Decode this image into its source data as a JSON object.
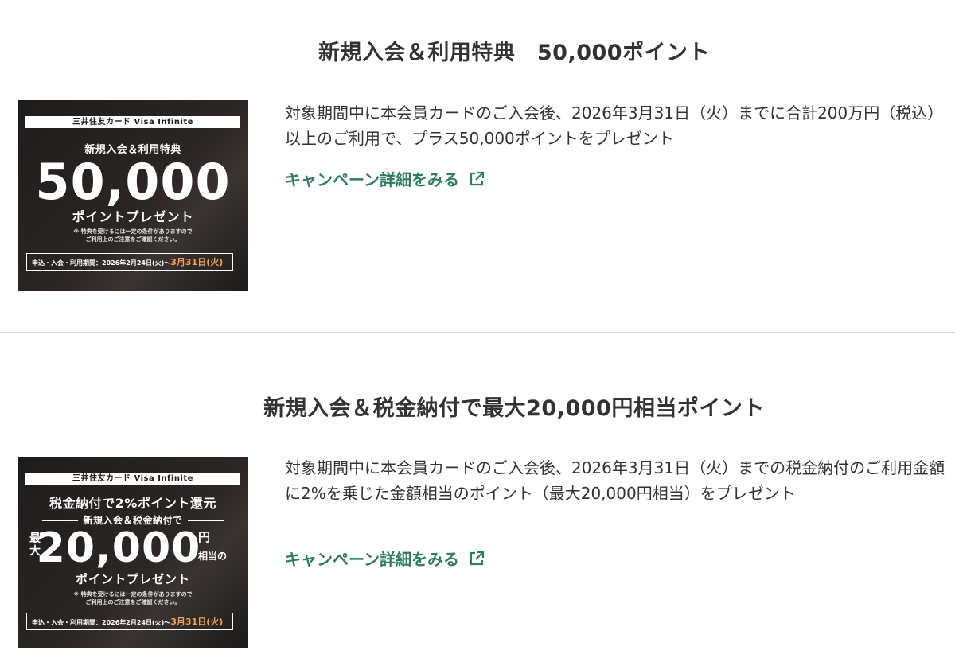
{
  "sections": [
    {
      "title": "新規入会＆利用特典　50,000ポイント",
      "description": "対象期間中に本会員カードのご入会後、2026年3月31日（火）までに合計200万円（税込）以上のご利用で、プラス50,000ポイントをプレゼント",
      "link_label": "キャンペーン詳細をみる",
      "link_icon": "external-link-icon",
      "banner": {
        "brand": "三井住友カード Visa Infinite",
        "subtitle": "新規入会＆利用特典",
        "amount": "50,000",
        "unit_line": "ポイントプレゼント",
        "note_1": "※ 特典を受けるには一定の条件がありますので",
        "note_2": "ご利用上のご注意をご確認ください。",
        "period_label": "申込・入会・利用期間：2026年2月24日(火)〜",
        "period_end": "3月31日(火)"
      }
    },
    {
      "title": "新規入会＆税金納付で最大20,000円相当ポイント",
      "description": "対象期間中に本会員カードのご入会後、2026年3月31日（火）までの税金納付のご利用金額に2%を乗じた金額相当のポイント（最大20,000円相当）をプレゼント",
      "link_label": "キャンペーン詳細をみる",
      "link_icon": "external-link-icon",
      "banner": {
        "brand": "三井住友カード Visa Infinite",
        "headline": "税金納付で2%ポイント還元",
        "subtitle": "新規入会＆税金納付で",
        "max_label": "最大",
        "amount": "20,000",
        "yen": "円",
        "soutou": "相当の",
        "unit_line": "ポイントプレゼント",
        "note_1": "※ 特典を受けるには一定の条件がありますので",
        "note_2": "ご利用上のご注意をご確認ください。",
        "period_label": "申込・入会・利用期間：2026年2月24日(火)〜",
        "period_end": "3月31日(火)"
      }
    }
  ],
  "colors": {
    "link": "#2e7d63",
    "text": "#333333",
    "banner_bg": "#231f1e",
    "accent": "#f0a15b",
    "separator": "#dcdcdc"
  }
}
